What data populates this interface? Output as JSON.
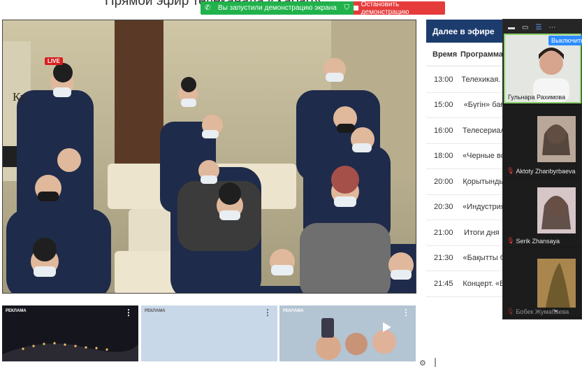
{
  "page": {
    "title": "Прямой эфир телеканала «Хабар»"
  },
  "share_bar": {
    "status_text": "Вы запустили демонстрацию экрана",
    "stop_label": "Остановить демонстрацию",
    "status_color": "#21b24b",
    "stop_color": "#e63b3b"
  },
  "video": {
    "live_label": "LIVE",
    "logo_text": "Ку"
  },
  "schedule": {
    "heading": "Далее в эфире",
    "col_time": "Время",
    "col_program": "Программа",
    "rows": [
      {
        "time": "13:00",
        "program": "Телехикая. «"
      },
      {
        "time": "15:00",
        "program": "«Бүгін» бағ"
      },
      {
        "time": "16:00",
        "program": "Телесериал"
      },
      {
        "time": "18:00",
        "program": "«Черные во"
      },
      {
        "time": "20:00",
        "program": "Қорытынды"
      },
      {
        "time": "20:30",
        "program": "«Индустрия"
      },
      {
        "time": "21:00",
        "program": "Итоги дня"
      },
      {
        "time": "21:30",
        "program": "«Бақытты б"
      },
      {
        "time": "21:45",
        "program": "Концерт. «Б"
      }
    ],
    "accent_color": "#1c3c6e"
  },
  "ads": [
    {
      "tag": "РЕКЛАМА",
      "menu": "⋮"
    },
    {
      "tag": "РЕКЛАМА",
      "menu": "⋮"
    },
    {
      "tag": "РЕКЛАМА",
      "menu": "⋮"
    }
  ],
  "zoom_panel": {
    "switch_label": "Выключить",
    "participants": [
      {
        "name": "Гульнара Рахимова",
        "muted": false
      },
      {
        "name": "Aktoty Zhanbyrbaeva",
        "muted": true
      },
      {
        "name": "Serik Zhansaya",
        "muted": true
      },
      {
        "name": "Бобек Жумабаева",
        "muted": true
      }
    ],
    "scroll_icon": "chevron-down-icon"
  }
}
